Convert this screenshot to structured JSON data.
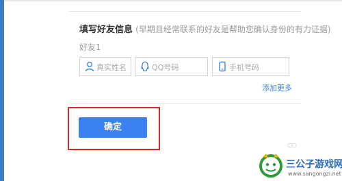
{
  "form": {
    "title": "填写好友信息",
    "hint": "(早期且经常联系的好友是帮助您确认身份的有力证据)",
    "friend_label": "好友1",
    "fields": [
      {
        "icon": "person-icon",
        "placeholder": "真实姓名"
      },
      {
        "icon": "qq-icon",
        "placeholder": "QQ号码"
      },
      {
        "icon": "phone-icon",
        "placeholder": "手机号码"
      }
    ],
    "add_more": "添加更多",
    "confirm_label": "确定"
  },
  "watermark": {
    "title": "三公子游戏网",
    "url": "www.sangongzi.net"
  },
  "colors": {
    "primary_button": "#3b82f0",
    "link": "#3c84d6",
    "highlight_box": "#e02424",
    "scrollbar": "#3d7dbf"
  }
}
